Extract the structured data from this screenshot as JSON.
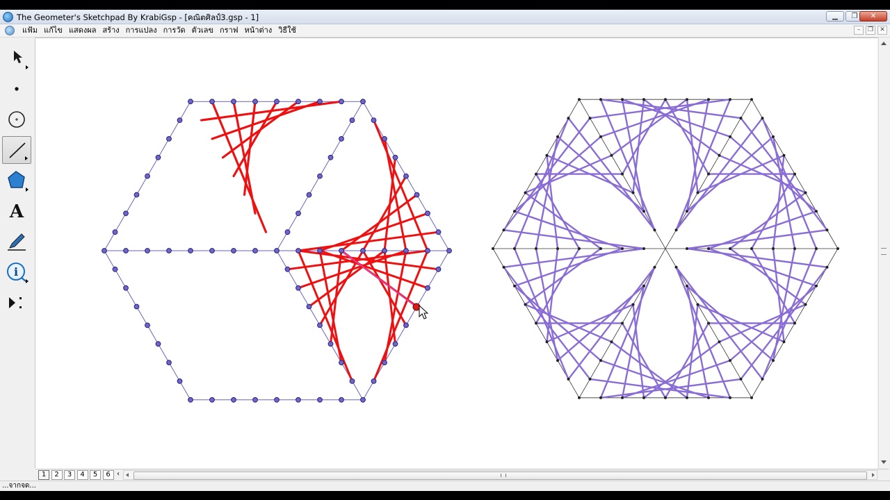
{
  "window": {
    "title": "The Geometer's Sketchpad By KrabiGsp - [คณิตศิลป์3.gsp - 1]",
    "buttons": [
      "minimize",
      "maximize",
      "close"
    ]
  },
  "menubar": {
    "items": [
      "แฟ้ม",
      "แก้ไข",
      "แสดงผล",
      "สร้าง",
      "การแปลง",
      "การวัด",
      "ตัวเลข",
      "กราฟ",
      "หน้าต่าง",
      "วิธีใช้"
    ]
  },
  "toolbox": {
    "tools": [
      {
        "name": "arrow-tool",
        "icon": "select-arrow-icon"
      },
      {
        "name": "point-tool",
        "icon": "point-icon"
      },
      {
        "name": "compass-tool",
        "icon": "circle-icon"
      },
      {
        "name": "straightedge-tool",
        "icon": "segment-icon",
        "active": true
      },
      {
        "name": "polygon-tool",
        "icon": "polygon-icon"
      },
      {
        "name": "text-tool",
        "icon": "text-A-icon"
      },
      {
        "name": "marker-tool",
        "icon": "pen-icon"
      },
      {
        "name": "information-tool",
        "icon": "info-icon"
      },
      {
        "name": "custom-tool",
        "icon": "custom-tools-icon"
      }
    ],
    "text_tool_glyph": "A",
    "info_tool_glyph": "i"
  },
  "canvas": {
    "colors": {
      "background": "#ffffff",
      "grid_line": "#6a62b8",
      "point_fill": "#7066c6",
      "point_stroke": "#262080",
      "red_string": "#ee1111",
      "purple_string": "#8a6dd4",
      "pink_segment": "#e040a0"
    }
  },
  "pages": {
    "tabs": [
      "1",
      "2",
      "3",
      "4",
      "5",
      "6"
    ],
    "current": "1"
  },
  "status": {
    "text": "...จากจด..."
  }
}
